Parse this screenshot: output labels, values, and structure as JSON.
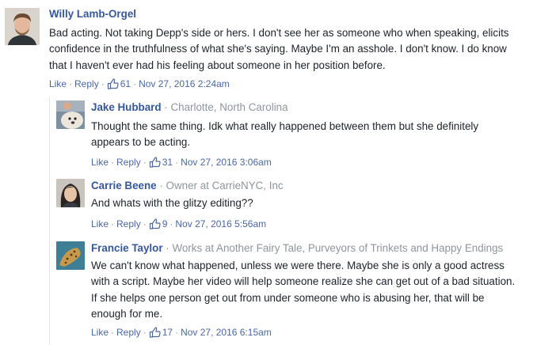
{
  "colors": {
    "name": "#365899",
    "link": "#4b67a1",
    "meta": "#90949c",
    "text": "#1d2129"
  },
  "comments": [
    {
      "author": "Willy Lamb-Orgel",
      "meta": "",
      "lines": [
        "Bad acting. Not taking Depp's side or hers. I don't see her as someone who when speaking, elicits",
        "confidence in the truthfulness of what she's saying. Maybe I'm an asshole. I don't know. I do know",
        "that I haven't ever had his feeling about someone in her position before."
      ],
      "like": "Like",
      "reply": "Reply",
      "likes": "61",
      "time": "Nov 27, 2016 2:24am"
    },
    {
      "author": "Jake Hubbard",
      "meta": "Charlotte, North Carolina",
      "lines": [
        "Thought the same thing. Idk what really happened between them but she definitely",
        "appears to be acting."
      ],
      "like": "Like",
      "reply": "Reply",
      "likes": "31",
      "time": "Nov 27, 2016 3:06am"
    },
    {
      "author": "Carrie Beene",
      "meta": "Owner at CarrieNYC, Inc",
      "lines": [
        "And whats with the glitzy editing??"
      ],
      "like": "Like",
      "reply": "Reply",
      "likes": "9",
      "time": "Nov 27, 2016 5:56am"
    },
    {
      "author": "Francie Taylor",
      "meta": "Works at Another Fairy Tale, Purveyors of Trinkets and Happy Endings",
      "lines": [
        "We can't know what happened, unless we were there. Maybe she is only a good actress",
        "with a script. Maybe her video will help someone realize she can get out of a bad situation.",
        "If she helps one person get out from under someone who is abusing her, that will be",
        "enough for me."
      ],
      "like": "Like",
      "reply": "Reply",
      "likes": "17",
      "time": "Nov 27, 2016 6:15am"
    }
  ]
}
